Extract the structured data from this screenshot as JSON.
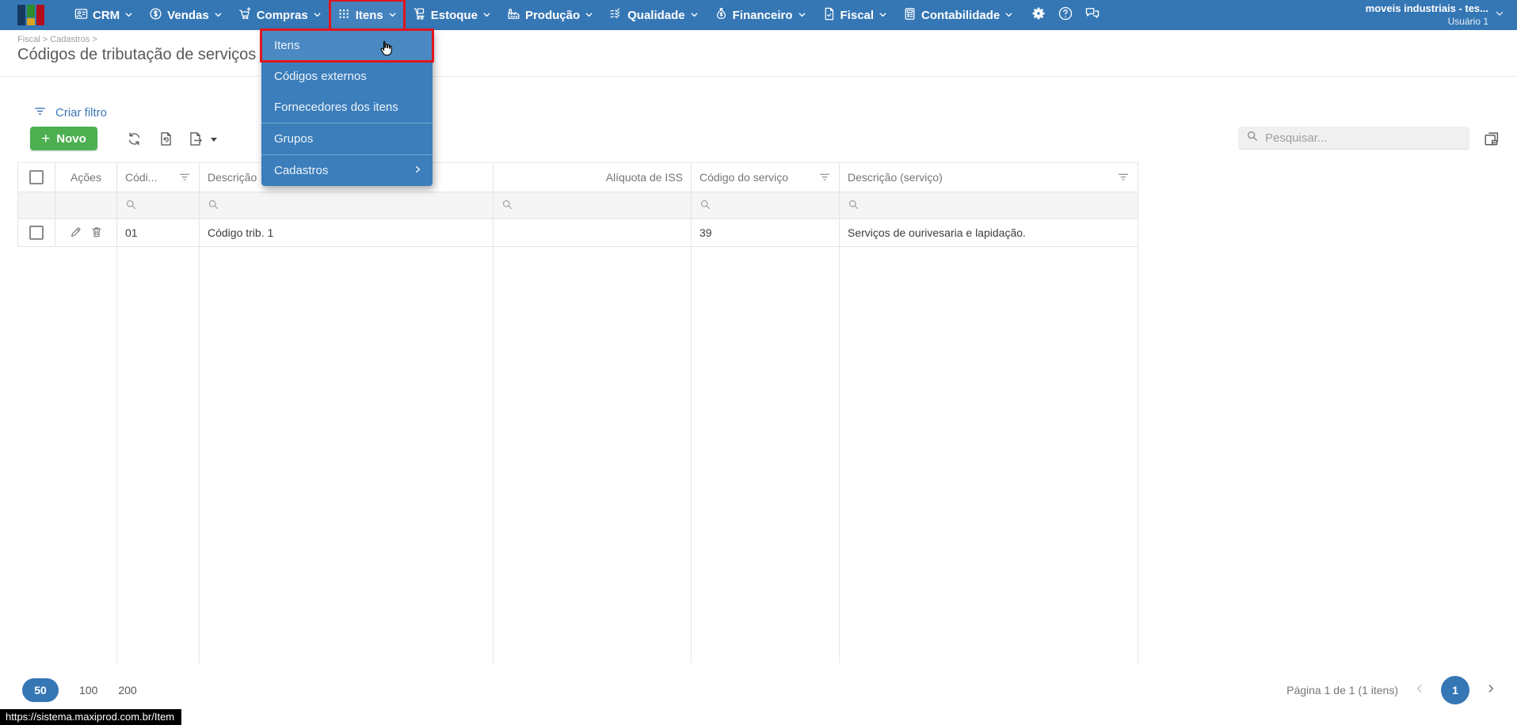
{
  "navbar": {
    "items": [
      {
        "label": "CRM"
      },
      {
        "label": "Vendas"
      },
      {
        "label": "Compras"
      },
      {
        "label": "Itens"
      },
      {
        "label": "Estoque"
      },
      {
        "label": "Produção"
      },
      {
        "label": "Qualidade"
      },
      {
        "label": "Financeiro"
      },
      {
        "label": "Fiscal"
      },
      {
        "label": "Contabilidade"
      }
    ],
    "user": {
      "company": "moveis industriais - tes...",
      "name": "Usuário 1"
    }
  },
  "menu_dropdown": {
    "items": [
      {
        "label": "Itens"
      },
      {
        "label": "Códigos externos"
      },
      {
        "label": "Fornecedores dos itens"
      },
      {
        "label": "Grupos"
      },
      {
        "label": "Cadastros"
      }
    ]
  },
  "page": {
    "breadcrumb": "Fiscal > Cadastros >",
    "title": "Códigos de tributação de serviços"
  },
  "toolbar": {
    "create_filter": "Criar filtro",
    "new_button": "Novo",
    "search_placeholder": "Pesquisar..."
  },
  "table": {
    "headers": {
      "acoes": "Ações",
      "codigo": "Códi...",
      "descricao": "Descrição",
      "aliquota": "Alíquota de ISS",
      "codigo_servico": "Código do serviço",
      "descricao_servico": "Descrição (serviço)"
    },
    "rows": [
      {
        "codigo": "01",
        "descricao": "Código trib. 1",
        "aliquota": "",
        "codigo_servico": "39",
        "descricao_servico": "Serviços de ourivesaria e lapidação."
      }
    ]
  },
  "pagination": {
    "sizes": [
      "50",
      "100",
      "200"
    ],
    "active_size": "50",
    "info": "Página 1 de 1 (1 itens)",
    "current_page": "1"
  },
  "statusbar": {
    "url": "https://sistema.maxiprod.com.br/Item"
  },
  "colors": {
    "navbar": "#3577b5",
    "dropdown": "#3b7ebb",
    "highlight_red": "#e1161d",
    "green": "#4caf50",
    "link_blue": "#3a77b5"
  }
}
